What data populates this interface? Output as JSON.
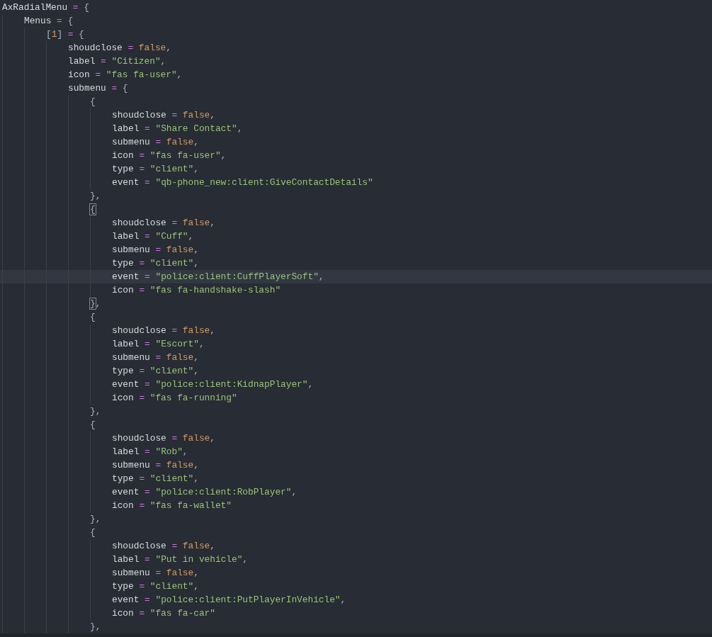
{
  "editor": {
    "lines": [
      {
        "tokens": [
          {
            "kind": "ident",
            "text": "AxRadialMenu"
          },
          {
            "kind": "op",
            "text": " = "
          },
          {
            "kind": "punct",
            "text": "{"
          }
        ],
        "children": [
          {
            "tokens": [
              {
                "kind": "ident",
                "text": "Menus"
              },
              {
                "kind": "op",
                "text": " = "
              },
              {
                "kind": "punct",
                "text": "{"
              }
            ],
            "children": [
              {
                "tokens": [
                  {
                    "kind": "punct",
                    "text": "["
                  },
                  {
                    "kind": "num",
                    "text": "1"
                  },
                  {
                    "kind": "punct",
                    "text": "]"
                  },
                  {
                    "kind": "op",
                    "text": " = "
                  },
                  {
                    "kind": "punct",
                    "text": "{"
                  }
                ],
                "children": [
                  {
                    "tokens": [
                      {
                        "kind": "ident",
                        "text": "shoudclose"
                      },
                      {
                        "kind": "op",
                        "text": " = "
                      },
                      {
                        "kind": "bool",
                        "text": "false"
                      },
                      {
                        "kind": "punct",
                        "text": ","
                      }
                    ]
                  },
                  {
                    "tokens": [
                      {
                        "kind": "ident",
                        "text": "label"
                      },
                      {
                        "kind": "op",
                        "text": " = "
                      },
                      {
                        "kind": "str",
                        "text": "\"Citizen\""
                      },
                      {
                        "kind": "punct",
                        "text": ","
                      }
                    ]
                  },
                  {
                    "tokens": [
                      {
                        "kind": "ident",
                        "text": "icon"
                      },
                      {
                        "kind": "op",
                        "text": " = "
                      },
                      {
                        "kind": "str",
                        "text": "\"fas fa-user\""
                      },
                      {
                        "kind": "punct",
                        "text": ","
                      }
                    ]
                  },
                  {
                    "tokens": [
                      {
                        "kind": "ident",
                        "text": "submenu"
                      },
                      {
                        "kind": "op",
                        "text": " = "
                      },
                      {
                        "kind": "punct",
                        "text": "{"
                      }
                    ],
                    "children": [
                      {
                        "tokens": [
                          {
                            "kind": "punct",
                            "text": "{"
                          }
                        ],
                        "children": [
                          {
                            "tokens": [
                              {
                                "kind": "ident",
                                "text": "shoudclose"
                              },
                              {
                                "kind": "op",
                                "text": " = "
                              },
                              {
                                "kind": "bool",
                                "text": "false"
                              },
                              {
                                "kind": "punct",
                                "text": ","
                              }
                            ]
                          },
                          {
                            "tokens": [
                              {
                                "kind": "ident",
                                "text": "label"
                              },
                              {
                                "kind": "op",
                                "text": " = "
                              },
                              {
                                "kind": "str",
                                "text": "\"Share Contact\""
                              },
                              {
                                "kind": "punct",
                                "text": ","
                              }
                            ]
                          },
                          {
                            "tokens": [
                              {
                                "kind": "ident",
                                "text": "submenu"
                              },
                              {
                                "kind": "op",
                                "text": " = "
                              },
                              {
                                "kind": "bool",
                                "text": "false"
                              },
                              {
                                "kind": "punct",
                                "text": ","
                              }
                            ]
                          },
                          {
                            "tokens": [
                              {
                                "kind": "ident",
                                "text": "icon"
                              },
                              {
                                "kind": "op",
                                "text": " = "
                              },
                              {
                                "kind": "str",
                                "text": "\"fas fa-user\""
                              },
                              {
                                "kind": "punct",
                                "text": ","
                              }
                            ]
                          },
                          {
                            "tokens": [
                              {
                                "kind": "ident",
                                "text": "type"
                              },
                              {
                                "kind": "op",
                                "text": " = "
                              },
                              {
                                "kind": "str",
                                "text": "\"client\""
                              },
                              {
                                "kind": "punct",
                                "text": ","
                              }
                            ]
                          },
                          {
                            "tokens": [
                              {
                                "kind": "ident",
                                "text": "event"
                              },
                              {
                                "kind": "op",
                                "text": " = "
                              },
                              {
                                "kind": "str",
                                "text": "\"qb-phone_new:client:GiveContactDetails\""
                              }
                            ]
                          }
                        ]
                      },
                      {
                        "tokens": [
                          {
                            "kind": "punct",
                            "text": "},"
                          }
                        ]
                      },
                      {
                        "tokens": [
                          {
                            "kind": "punct",
                            "text": "{",
                            "matched": true
                          }
                        ],
                        "children": [
                          {
                            "tokens": [
                              {
                                "kind": "ident",
                                "text": "shoudclose"
                              },
                              {
                                "kind": "op",
                                "text": " = "
                              },
                              {
                                "kind": "bool",
                                "text": "false"
                              },
                              {
                                "kind": "punct",
                                "text": ","
                              }
                            ]
                          },
                          {
                            "tokens": [
                              {
                                "kind": "ident",
                                "text": "label"
                              },
                              {
                                "kind": "op",
                                "text": " = "
                              },
                              {
                                "kind": "str",
                                "text": "\"Cuff\""
                              },
                              {
                                "kind": "punct",
                                "text": ","
                              }
                            ]
                          },
                          {
                            "tokens": [
                              {
                                "kind": "ident",
                                "text": "submenu"
                              },
                              {
                                "kind": "op",
                                "text": " = "
                              },
                              {
                                "kind": "bool",
                                "text": "false"
                              },
                              {
                                "kind": "punct",
                                "text": ","
                              }
                            ]
                          },
                          {
                            "tokens": [
                              {
                                "kind": "ident",
                                "text": "type"
                              },
                              {
                                "kind": "op",
                                "text": " = "
                              },
                              {
                                "kind": "str",
                                "text": "\"client\""
                              },
                              {
                                "kind": "punct",
                                "text": ","
                              }
                            ]
                          },
                          {
                            "current": true,
                            "tokens": [
                              {
                                "kind": "ident",
                                "text": "event"
                              },
                              {
                                "kind": "op",
                                "text": " = "
                              },
                              {
                                "kind": "str",
                                "text": "\"police:client:CuffPlayerSoft\""
                              },
                              {
                                "kind": "punct",
                                "text": ","
                              }
                            ]
                          },
                          {
                            "tokens": [
                              {
                                "kind": "ident",
                                "text": "icon"
                              },
                              {
                                "kind": "op",
                                "text": " = "
                              },
                              {
                                "kind": "str",
                                "text": "\"fas fa-handshake-slash\""
                              }
                            ]
                          }
                        ]
                      },
                      {
                        "tokens": [
                          {
                            "kind": "punct",
                            "text": "}",
                            "matched": true
                          },
                          {
                            "kind": "punct",
                            "text": ","
                          }
                        ]
                      },
                      {
                        "tokens": [
                          {
                            "kind": "punct",
                            "text": "{"
                          }
                        ],
                        "children": [
                          {
                            "tokens": [
                              {
                                "kind": "ident",
                                "text": "shoudclose"
                              },
                              {
                                "kind": "op",
                                "text": " = "
                              },
                              {
                                "kind": "bool",
                                "text": "false"
                              },
                              {
                                "kind": "punct",
                                "text": ","
                              }
                            ]
                          },
                          {
                            "tokens": [
                              {
                                "kind": "ident",
                                "text": "label"
                              },
                              {
                                "kind": "op",
                                "text": " = "
                              },
                              {
                                "kind": "str",
                                "text": "\"Escort\""
                              },
                              {
                                "kind": "punct",
                                "text": ","
                              }
                            ]
                          },
                          {
                            "tokens": [
                              {
                                "kind": "ident",
                                "text": "submenu"
                              },
                              {
                                "kind": "op",
                                "text": " = "
                              },
                              {
                                "kind": "bool",
                                "text": "false"
                              },
                              {
                                "kind": "punct",
                                "text": ","
                              }
                            ]
                          },
                          {
                            "tokens": [
                              {
                                "kind": "ident",
                                "text": "type"
                              },
                              {
                                "kind": "op",
                                "text": " = "
                              },
                              {
                                "kind": "str",
                                "text": "\"client\""
                              },
                              {
                                "kind": "punct",
                                "text": ","
                              }
                            ]
                          },
                          {
                            "tokens": [
                              {
                                "kind": "ident",
                                "text": "event"
                              },
                              {
                                "kind": "op",
                                "text": " = "
                              },
                              {
                                "kind": "str",
                                "text": "\"police:client:KidnapPlayer\""
                              },
                              {
                                "kind": "punct",
                                "text": ","
                              }
                            ]
                          },
                          {
                            "tokens": [
                              {
                                "kind": "ident",
                                "text": "icon"
                              },
                              {
                                "kind": "op",
                                "text": " = "
                              },
                              {
                                "kind": "str",
                                "text": "\"fas fa-running\""
                              }
                            ]
                          }
                        ]
                      },
                      {
                        "tokens": [
                          {
                            "kind": "punct",
                            "text": "},"
                          }
                        ]
                      },
                      {
                        "tokens": [
                          {
                            "kind": "punct",
                            "text": "{"
                          }
                        ],
                        "children": [
                          {
                            "tokens": [
                              {
                                "kind": "ident",
                                "text": "shoudclose"
                              },
                              {
                                "kind": "op",
                                "text": " = "
                              },
                              {
                                "kind": "bool",
                                "text": "false"
                              },
                              {
                                "kind": "punct",
                                "text": ","
                              }
                            ]
                          },
                          {
                            "tokens": [
                              {
                                "kind": "ident",
                                "text": "label"
                              },
                              {
                                "kind": "op",
                                "text": " = "
                              },
                              {
                                "kind": "str",
                                "text": "\"Rob\""
                              },
                              {
                                "kind": "punct",
                                "text": ","
                              }
                            ]
                          },
                          {
                            "tokens": [
                              {
                                "kind": "ident",
                                "text": "submenu"
                              },
                              {
                                "kind": "op",
                                "text": " = "
                              },
                              {
                                "kind": "bool",
                                "text": "false"
                              },
                              {
                                "kind": "punct",
                                "text": ","
                              }
                            ]
                          },
                          {
                            "tokens": [
                              {
                                "kind": "ident",
                                "text": "type"
                              },
                              {
                                "kind": "op",
                                "text": " = "
                              },
                              {
                                "kind": "str",
                                "text": "\"client\""
                              },
                              {
                                "kind": "punct",
                                "text": ","
                              }
                            ]
                          },
                          {
                            "tokens": [
                              {
                                "kind": "ident",
                                "text": "event"
                              },
                              {
                                "kind": "op",
                                "text": " = "
                              },
                              {
                                "kind": "str",
                                "text": "\"police:client:RobPlayer\""
                              },
                              {
                                "kind": "punct",
                                "text": ","
                              }
                            ]
                          },
                          {
                            "tokens": [
                              {
                                "kind": "ident",
                                "text": "icon"
                              },
                              {
                                "kind": "op",
                                "text": " = "
                              },
                              {
                                "kind": "str",
                                "text": "\"fas fa-wallet\""
                              }
                            ]
                          }
                        ]
                      },
                      {
                        "tokens": [
                          {
                            "kind": "punct",
                            "text": "},"
                          }
                        ]
                      },
                      {
                        "tokens": [
                          {
                            "kind": "punct",
                            "text": "{"
                          }
                        ],
                        "children": [
                          {
                            "tokens": [
                              {
                                "kind": "ident",
                                "text": "shoudclose"
                              },
                              {
                                "kind": "op",
                                "text": " = "
                              },
                              {
                                "kind": "bool",
                                "text": "false"
                              },
                              {
                                "kind": "punct",
                                "text": ","
                              }
                            ]
                          },
                          {
                            "tokens": [
                              {
                                "kind": "ident",
                                "text": "label"
                              },
                              {
                                "kind": "op",
                                "text": " = "
                              },
                              {
                                "kind": "str",
                                "text": "\"Put in vehicle\""
                              },
                              {
                                "kind": "punct",
                                "text": ","
                              }
                            ]
                          },
                          {
                            "tokens": [
                              {
                                "kind": "ident",
                                "text": "submenu"
                              },
                              {
                                "kind": "op",
                                "text": " = "
                              },
                              {
                                "kind": "bool",
                                "text": "false"
                              },
                              {
                                "kind": "punct",
                                "text": ","
                              }
                            ]
                          },
                          {
                            "tokens": [
                              {
                                "kind": "ident",
                                "text": "type"
                              },
                              {
                                "kind": "op",
                                "text": " = "
                              },
                              {
                                "kind": "str",
                                "text": "\"client\""
                              },
                              {
                                "kind": "punct",
                                "text": ","
                              }
                            ]
                          },
                          {
                            "tokens": [
                              {
                                "kind": "ident",
                                "text": "event"
                              },
                              {
                                "kind": "op",
                                "text": " = "
                              },
                              {
                                "kind": "str",
                                "text": "\"police:client:PutPlayerInVehicle\""
                              },
                              {
                                "kind": "punct",
                                "text": ","
                              }
                            ]
                          },
                          {
                            "tokens": [
                              {
                                "kind": "ident",
                                "text": "icon"
                              },
                              {
                                "kind": "op",
                                "text": " = "
                              },
                              {
                                "kind": "str",
                                "text": "\"fas fa-car\""
                              }
                            ]
                          }
                        ]
                      },
                      {
                        "tokens": [
                          {
                            "kind": "punct",
                            "text": "},"
                          }
                        ]
                      }
                    ]
                  }
                ]
              }
            ]
          }
        ]
      }
    ]
  }
}
